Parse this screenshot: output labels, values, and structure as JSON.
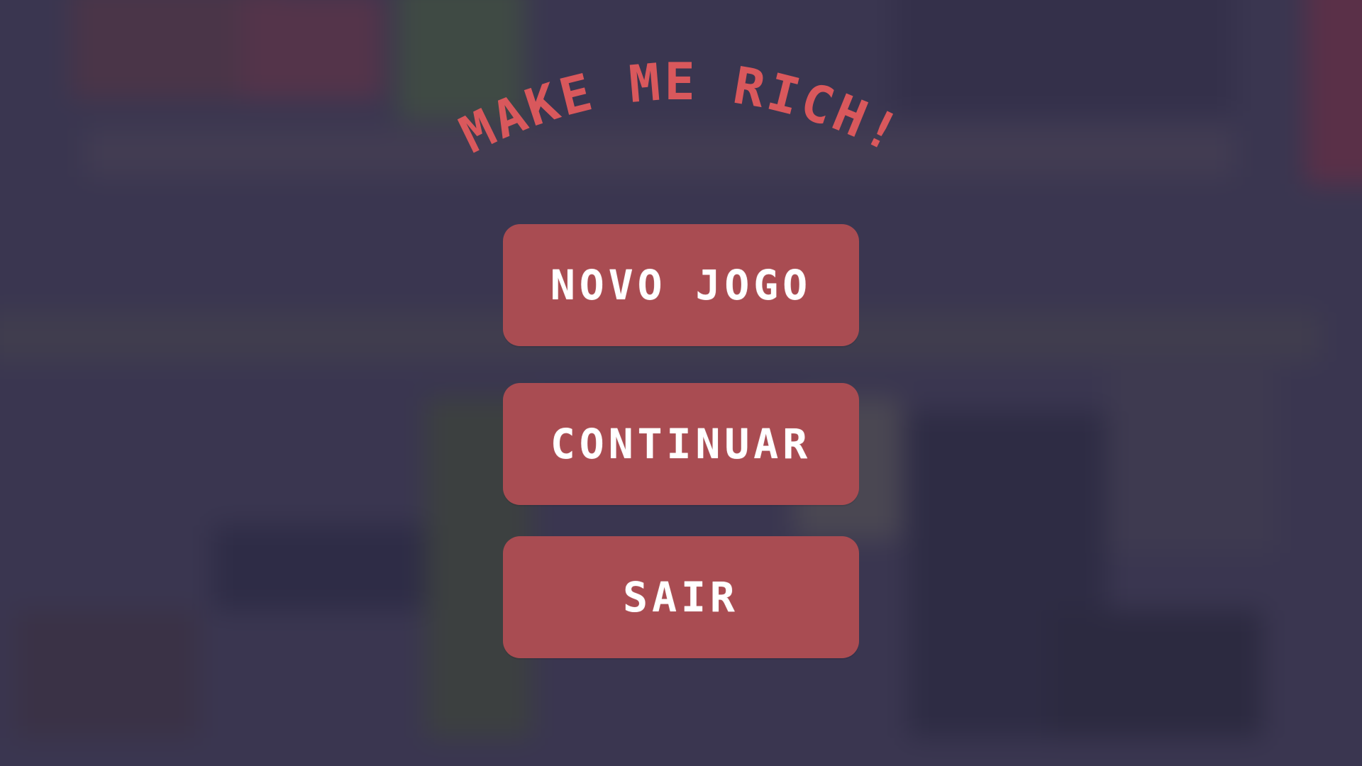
{
  "game": {
    "title": "MAKE ME RICH!",
    "title_color": "#d9585c"
  },
  "menu": {
    "new_game_label": "NOVO JOGO",
    "continue_label": "CONTINUAR",
    "exit_label": "SAIR",
    "button_color": "#a94c52",
    "text_color": "#ffffff"
  }
}
